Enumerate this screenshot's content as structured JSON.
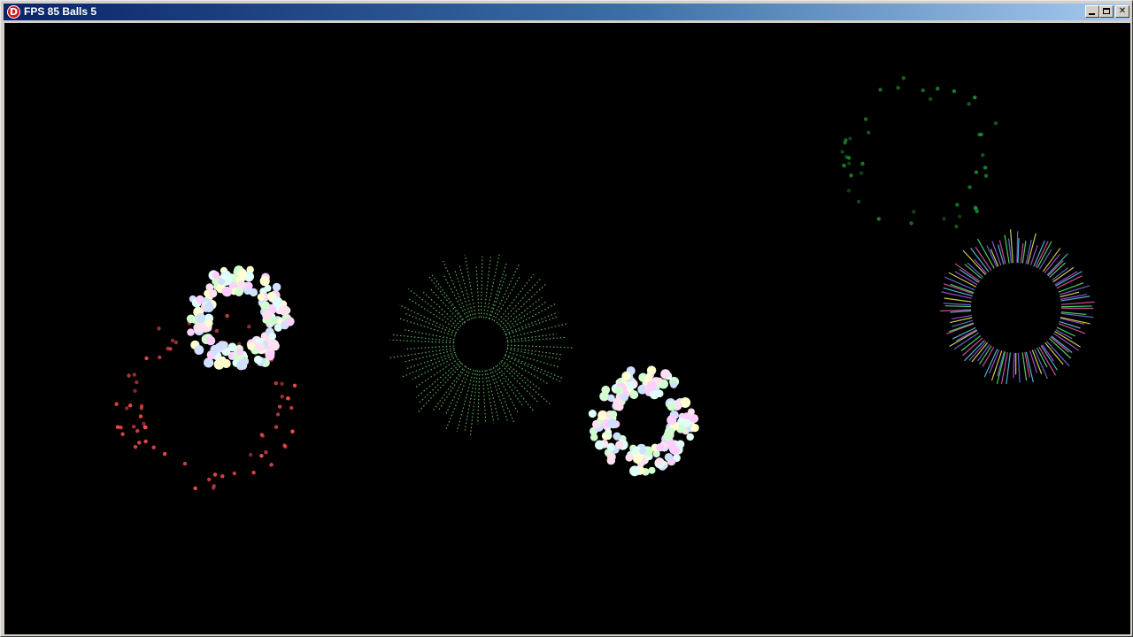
{
  "window": {
    "title": "FPS 85 Balls 5",
    "icon_letter": "D",
    "icon_color": "#d8161e",
    "titlebar_color": "#0a246a",
    "background_color": "#000000"
  },
  "titlebar_buttons": {
    "minimize": "minimize-icon",
    "maximize": "maximize-icon",
    "close_glyph": "✕",
    "close": "close-icon"
  },
  "scene": {
    "fps": 85,
    "balls": 5,
    "fireworks": [
      {
        "type": "dots",
        "color": "#ff4d4d",
        "count": 70
      },
      {
        "type": "ring",
        "color": "#e8fff0",
        "count": 160
      },
      {
        "type": "rays",
        "color": "#6ddc6d",
        "count": 72
      },
      {
        "type": "ring",
        "color": "#f0f0ff",
        "count": 160
      },
      {
        "type": "dots-faint",
        "color": "#1fa83a",
        "count": 45
      },
      {
        "type": "rays-multicolor",
        "color": "#c070ff",
        "count": 110
      }
    ]
  }
}
